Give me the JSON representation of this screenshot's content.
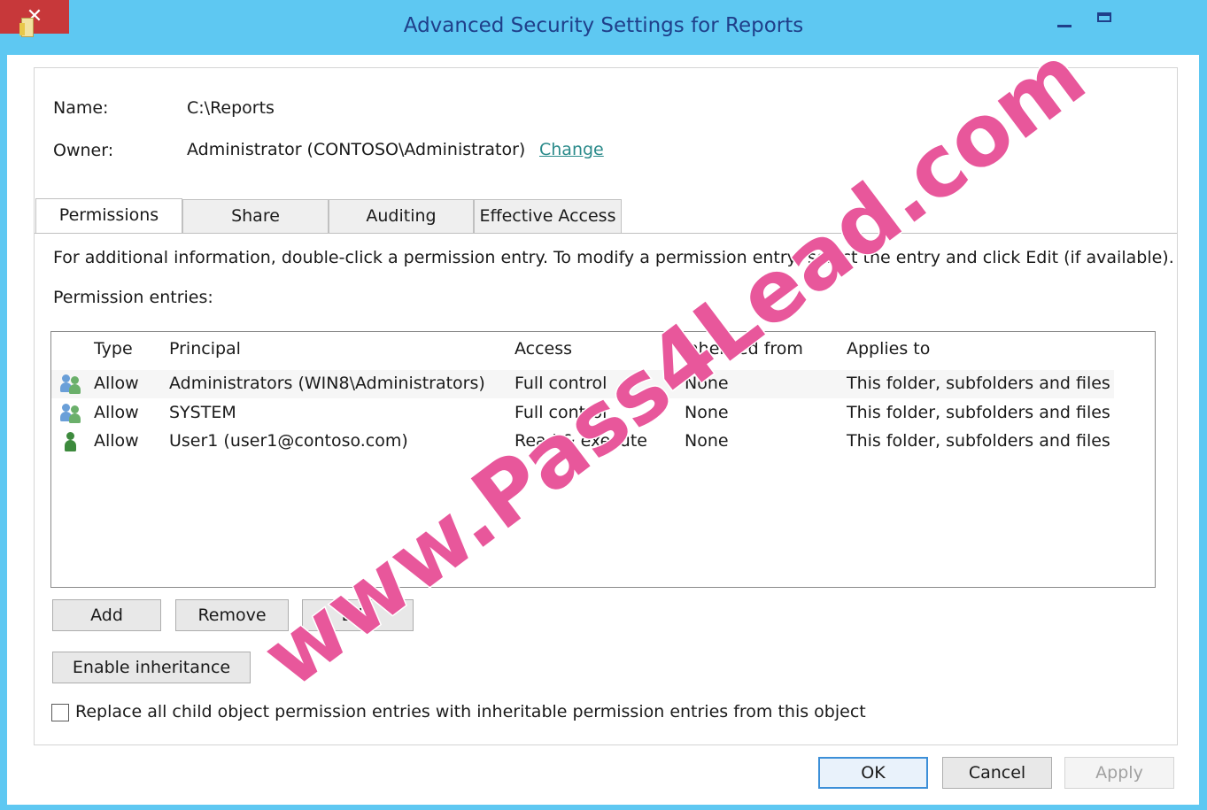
{
  "window": {
    "title": "Advanced Security Settings for Reports",
    "close_glyph": "✕"
  },
  "header": {
    "name_label": "Name:",
    "name_value": "C:\\Reports",
    "owner_label": "Owner:",
    "owner_value": "Administrator (CONTOSO\\Administrator)",
    "change_link": "Change"
  },
  "tabs": [
    {
      "label": "Permissions",
      "active": true
    },
    {
      "label": "Share",
      "active": false
    },
    {
      "label": "Auditing",
      "active": false
    },
    {
      "label": "Effective Access",
      "active": false
    }
  ],
  "instructions": "For additional information, double-click a permission entry. To modify a permission entry, select the entry and click Edit (if available).",
  "entries_label": "Permission entries:",
  "table": {
    "columns": [
      "Type",
      "Principal",
      "Access",
      "Inherited from",
      "Applies to"
    ],
    "rows": [
      {
        "icon": "group-icon",
        "type": "Allow",
        "principal": "Administrators (WIN8\\Administrators)",
        "access": "Full control",
        "inherited": "None",
        "applies": "This folder, subfolders and files"
      },
      {
        "icon": "group-icon",
        "type": "Allow",
        "principal": "SYSTEM",
        "access": "Full control",
        "inherited": "None",
        "applies": "This folder, subfolders and files"
      },
      {
        "icon": "user-icon",
        "type": "Allow",
        "principal": "User1 (user1@contoso.com)",
        "access": "Read & execute",
        "inherited": "None",
        "applies": "This folder, subfolders and files"
      }
    ]
  },
  "buttons": {
    "add": "Add",
    "remove": "Remove",
    "edit": "Edit",
    "enable_inheritance": "Enable inheritance",
    "ok": "OK",
    "cancel": "Cancel",
    "apply": "Apply"
  },
  "replace_checkbox": {
    "label": "Replace all child object permission entries with inheritable permission entries from this object",
    "checked": false
  },
  "watermark": "www.Pass4Lead.com"
}
